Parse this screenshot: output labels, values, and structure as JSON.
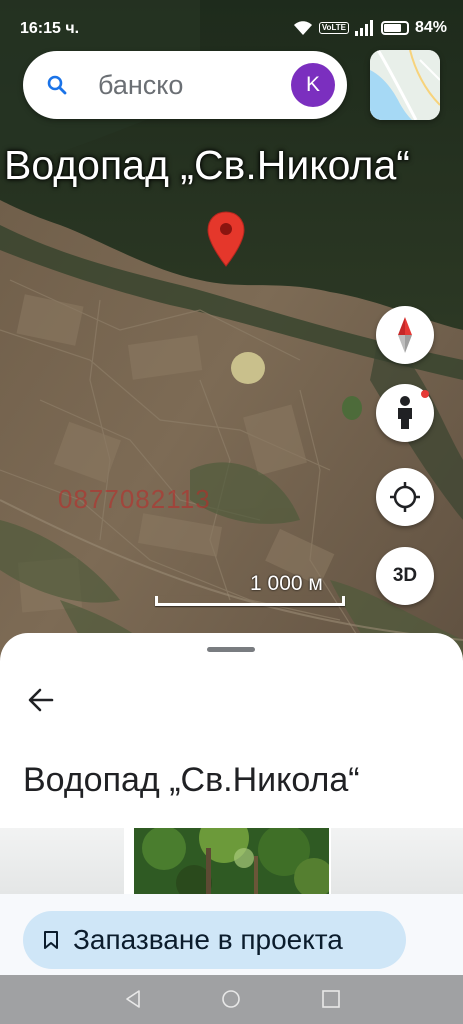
{
  "status_bar": {
    "time": "16:15 ч.",
    "network_badge": "VoLTE",
    "battery_percent": "84%",
    "battery_level": 0.84,
    "icons": [
      "wifi-icon",
      "volte-icon",
      "signal-icon",
      "battery-icon"
    ]
  },
  "search": {
    "query": "банско",
    "account_initial": "K",
    "account_color": "#7b2fbf"
  },
  "map": {
    "place_label": "Водопад „Св.Никола“",
    "watermark": "0877082113",
    "scale_text": "1 000 м",
    "pin_color": "#e5372b",
    "buttons": {
      "compass": "compass-icon",
      "street_view": "pegman-icon",
      "my_location": "my-location-icon",
      "three_d_label": "3D"
    }
  },
  "sheet": {
    "title": "Водопад „Св.Никола“",
    "save_button_label": "Запазване в проекта",
    "save_button_color": "#cfe6f7"
  },
  "nav_bar": {
    "items": [
      "back-icon",
      "home-icon",
      "recents-icon"
    ]
  }
}
